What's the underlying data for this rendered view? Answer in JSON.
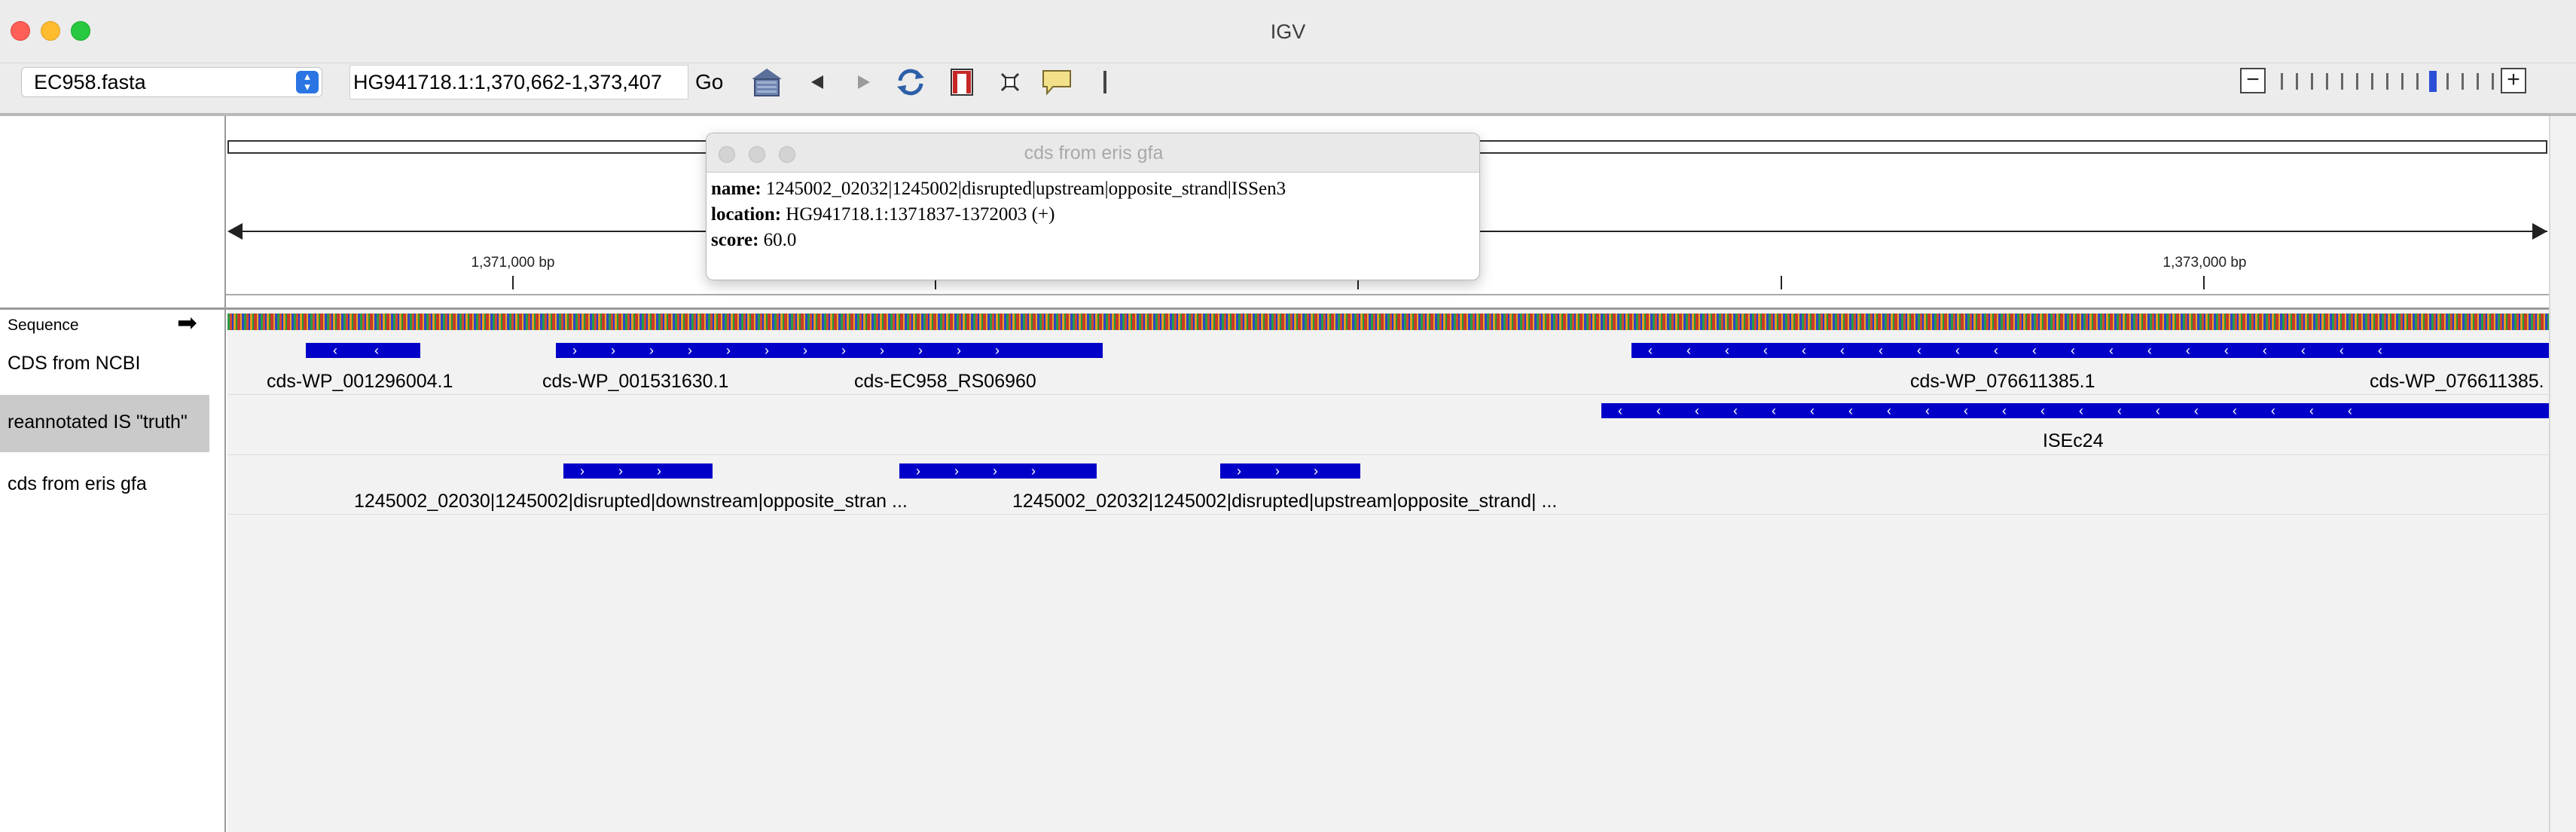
{
  "window": {
    "title": "IGV",
    "traffic_lights": {
      "close": "#fe5f57",
      "minimize": "#febc2e",
      "zoom": "#28c840"
    }
  },
  "toolbar": {
    "genome": "EC958.fasta",
    "locus": "HG941718.1:1,370,662-1,373,407",
    "go_label": "Go",
    "icons": [
      "home-icon",
      "back-icon",
      "forward-icon",
      "refresh-icon",
      "region-of-interest-icon",
      "fit-to-window-icon",
      "popup-text-icon",
      "ruler-toggle-icon"
    ],
    "zoom": {
      "minus": "−",
      "plus": "+",
      "level_fraction": 0.73
    }
  },
  "ruler": {
    "ticks": [
      "1,371,000 bp",
      "1,373,000 bp"
    ]
  },
  "tracks": [
    {
      "name": "Sequence",
      "arrow": "➡"
    },
    {
      "name": "CDS from NCBI",
      "features": [
        "cds-WP_001296004.1",
        "cds-WP_001531630.1",
        "cds-EC958_RS06960",
        "cds-WP_076611385.1",
        "cds-WP_076611385."
      ]
    },
    {
      "name": "reannotated IS \"truth\"",
      "features": [
        "ISEc24"
      ]
    },
    {
      "name": "cds from eris gfa",
      "features": [
        "1245002_02030|1245002|disrupted|downstream|opposite_stran ...",
        "1245002_02032|1245002|disrupted|upstream|opposite_strand| ..."
      ]
    }
  ],
  "popup": {
    "title": "cds from eris gfa",
    "name_key": "name:",
    "name_value": " 1245002_02032|1245002|disrupted|upstream|opposite_strand|ISSen3",
    "location_key": "location:",
    "location_value": " HG941718.1:1371837-1372003 (+)",
    "score_key": "score:",
    "score_value": " 60.0"
  },
  "colors": {
    "feature": "#0000c8",
    "selected_track_bg": "#cacaca"
  }
}
